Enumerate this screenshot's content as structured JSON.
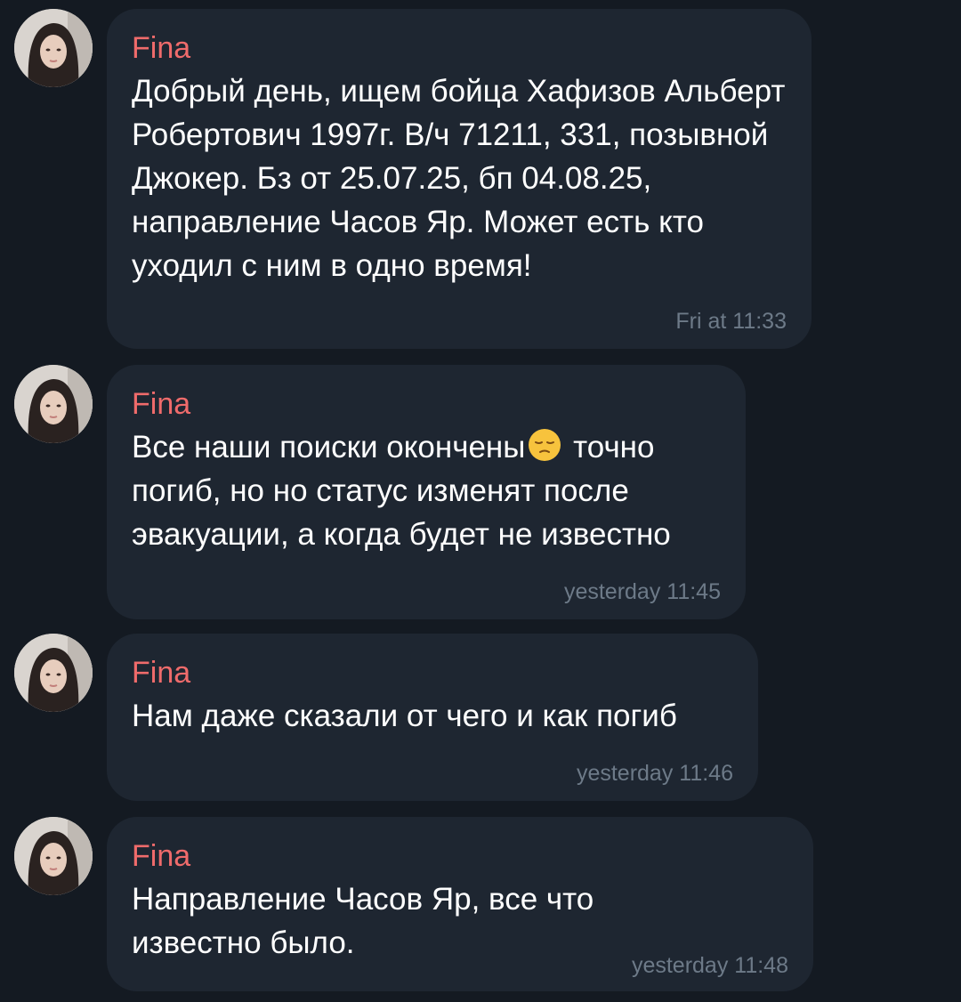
{
  "messages": [
    {
      "sender": "Fina",
      "text_parts": [
        "Добрый день, ищем бойца Хафизов Альберт Робертович 1997г. В/ч 71211, 331, позывной Джокер. Бз от 25.07.25, бп 04.08.25, направление Часов Яр. Может есть кто уходил с ним в одно время!"
      ],
      "time": "Fri at 11:33"
    },
    {
      "sender": "Fina",
      "text_before_emoji": "Все наши поиски окончены",
      "emoji": "pensive-face-icon",
      "text_after_emoji": " точно погиб, но но статус изменят после эвакуации, а когда будет не известно",
      "time": "yesterday 11:45"
    },
    {
      "sender": "Fina",
      "text": "Нам даже сказали от чего и как погиб",
      "time": "yesterday 11:46"
    },
    {
      "sender": "Fina",
      "text": "Направление Часов Яр, все что известно было.",
      "time": "yesterday 11:48"
    }
  ],
  "colors": {
    "background": "#141a22",
    "bubble": "#1e2631",
    "sender_name": "#ef6b6b",
    "message_text": "#ffffff",
    "timestamp": "#6d7a88"
  }
}
